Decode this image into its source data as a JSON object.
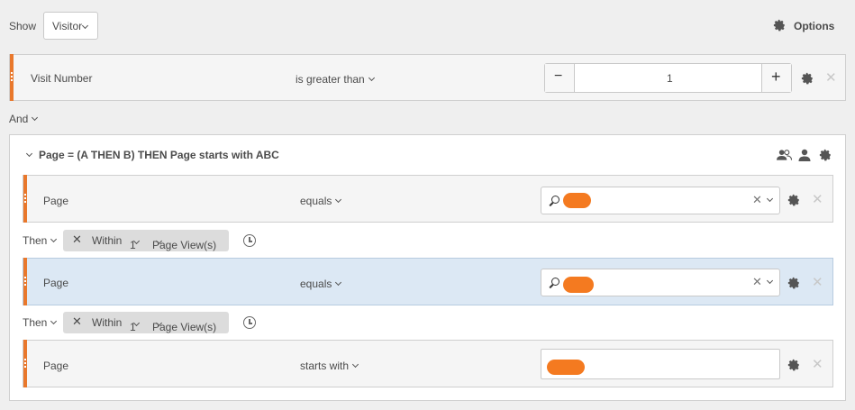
{
  "header": {
    "show_label": "Show",
    "show_select_value": "Visitor",
    "options_label": "Options",
    "icons": {
      "options": "gear-icon"
    }
  },
  "visit_rule": {
    "dimension": "Visit Number",
    "operator": "is greater than",
    "value": "1",
    "stepper_minus": "−",
    "stepper_plus": "+"
  },
  "logic": {
    "and_label": "And"
  },
  "container": {
    "title": "Page = (A THEN B) THEN Page starts with ABC",
    "icons": [
      "people-icon",
      "person-icon",
      "gear-icon"
    ],
    "rules": [
      {
        "dimension": "Page",
        "operator": "equals",
        "value_redacted": true
      },
      {
        "dimension": "Page",
        "operator": "equals",
        "value_redacted": true,
        "selected": true
      },
      {
        "dimension": "Page",
        "operator": "starts with",
        "value_redacted": true
      }
    ],
    "then_connectors": [
      {
        "then_label": "Then",
        "within_label": "Within",
        "count": "1",
        "unit": "Page View(s)"
      },
      {
        "then_label": "Then",
        "within_label": "Within",
        "count": "1",
        "unit": "Page View(s)"
      }
    ]
  },
  "colors": {
    "accent": "#e9782c",
    "selected_row": "#dce8f4",
    "redaction": "#f47a20"
  }
}
